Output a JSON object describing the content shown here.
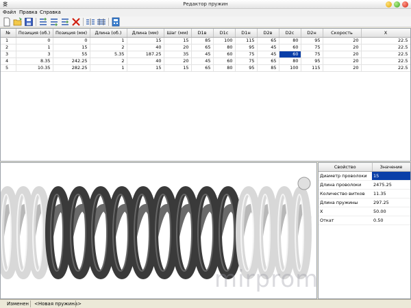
{
  "window": {
    "title": "Редактор пружин"
  },
  "menu": [
    "Файл",
    "Правка",
    "Справка"
  ],
  "toolbar": {
    "buttons": [
      {
        "name": "new-file-icon"
      },
      {
        "name": "open-folder-icon"
      },
      {
        "name": "save-disk-icon"
      },
      {
        "name": "insert-row-above-icon"
      },
      {
        "name": "insert-row-below-icon"
      },
      {
        "name": "append-row-icon"
      },
      {
        "name": "delete-row-icon"
      },
      {
        "name": "split-coil-icon"
      },
      {
        "name": "merge-coil-icon"
      },
      {
        "name": "calculator-icon"
      }
    ]
  },
  "grid": {
    "columns": [
      "№",
      "Позиция (об.)",
      "Позиция (мм)",
      "Длина (об.)",
      "Длина (мм)",
      "Шаг (мм)",
      "D1в",
      "D1с",
      "D1н",
      "D2в",
      "D2с",
      "D2н",
      "Скорость",
      "X"
    ],
    "rows": [
      [
        "1",
        "0",
        "0",
        "1",
        "15",
        "15",
        "85",
        "100",
        "115",
        "65",
        "80",
        "95",
        "20",
        "22.5"
      ],
      [
        "2",
        "1",
        "15",
        "2",
        "40",
        "20",
        "65",
        "80",
        "95",
        "45",
        "60",
        "75",
        "20",
        "22.5"
      ],
      [
        "3",
        "3",
        "55",
        "5.35",
        "187.25",
        "35",
        "45",
        "60",
        "75",
        "45",
        "60",
        "75",
        "20",
        "22.5"
      ],
      [
        "4",
        "8.35",
        "242.25",
        "2",
        "40",
        "20",
        "45",
        "60",
        "75",
        "65",
        "80",
        "95",
        "20",
        "22.5"
      ],
      [
        "5",
        "10.35",
        "282.25",
        "1",
        "15",
        "15",
        "65",
        "80",
        "95",
        "85",
        "100",
        "115",
        "20",
        "22.5"
      ]
    ],
    "selected_cell": {
      "row": 2,
      "col": 10
    }
  },
  "properties": {
    "headers": [
      "Свойство",
      "Значение"
    ],
    "rows": [
      [
        "Диаметр проволоки",
        "15"
      ],
      [
        "Длина проволоки",
        "2475.25"
      ],
      [
        "Количество витков",
        "11.35"
      ],
      [
        "Длина пружины",
        "297.25"
      ],
      [
        "X",
        "50.00"
      ],
      [
        "Откат",
        "0.50"
      ]
    ]
  },
  "watermark": "mirprom.com",
  "status": {
    "state": "Изменен",
    "file": "<Новая пружина>"
  },
  "colors": {
    "selection": "#0a3fa8",
    "coil_light": "#d8d8d8",
    "coil_dark": "#3a3a3a"
  }
}
